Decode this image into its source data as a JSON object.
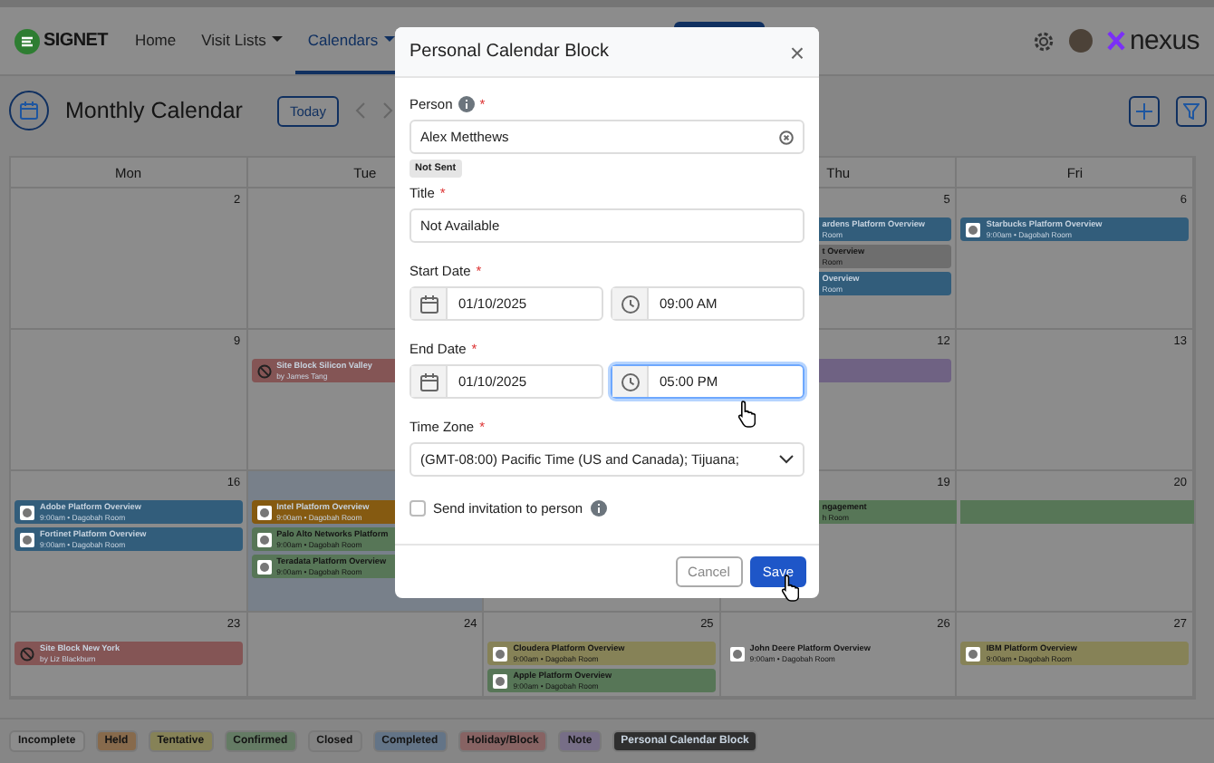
{
  "nav": {
    "logo": "SIGNET",
    "items": [
      {
        "label": "Home",
        "dropdown": false,
        "selected": false
      },
      {
        "label": "Visit Lists",
        "dropdown": true,
        "selected": false
      },
      {
        "label": "Calendars",
        "dropdown": true,
        "selected": true
      }
    ],
    "brand": "nexus"
  },
  "header": {
    "title": "Monthly Calendar",
    "today_button": "Today"
  },
  "calendar": {
    "weekdays": [
      "Mon",
      "Tue",
      "Thu",
      "Fri"
    ],
    "weeks": [
      {
        "days": [
          {
            "number": "2",
            "today": false
          },
          {
            "today": false
          },
          {
            "number": "5",
            "today": false,
            "events": [
              {
                "kind": "plain",
                "color": "#325d7b",
                "title": "ardens Platform Overview",
                "detail": "Room",
                "span": false
              },
              {
                "kind": "plain",
                "color": "#6e6e6e",
                "title": "t Overview",
                "detail": "Room",
                "span": false
              },
              {
                "kind": "plain",
                "color": "#325d7b",
                "title": "Overview",
                "detail": "Room",
                "span": false
              }
            ]
          },
          {
            "number": "6",
            "today": false,
            "events": [
              {
                "kind": "logo",
                "color": "#325d7b",
                "title": "Starbucks Platform Overview",
                "detail": "9:00am • Dagobah Room",
                "span": false
              }
            ]
          }
        ]
      },
      {
        "days": [
          {
            "number": "9",
            "today": false
          },
          {
            "today": false,
            "events": [
              {
                "kind": "block",
                "color": "#845555",
                "title": "Site Block Silicon Valley",
                "detail": "by James Tang",
                "span": false
              }
            ]
          },
          {
            "number": "12",
            "today": false,
            "events": [
              {
                "kind": "bar",
                "color": "#6f6283",
                "span": false
              }
            ]
          },
          {
            "number": "13",
            "today": false
          }
        ]
      },
      {
        "days": [
          {
            "number": "16",
            "today": false,
            "events": [
              {
                "kind": "logo",
                "color": "#325d7b",
                "title": "Adobe Platform Overview",
                "detail": "9:00am • Dagobah Room",
                "span": false
              },
              {
                "kind": "logo",
                "color": "#325d7b",
                "title": "Fortinet Platform Overview",
                "detail": "9:00am • Dagobah Room",
                "span": false
              }
            ]
          },
          {
            "today": true,
            "events": [
              {
                "kind": "logo",
                "color": "#855a11",
                "title": "Intel Platform Overview",
                "detail": "9:00am • Dagobah Room",
                "span": false
              },
              {
                "kind": "logo",
                "color": "#577657",
                "title": "Palo Alto Networks Platform",
                "detail": "9:00am • Dagobah Room",
                "span": false
              },
              {
                "kind": "logo",
                "color": "#577657",
                "title": "Teradata Platform Overview",
                "detail": "9:00am • Dagobah Room",
                "span": false
              }
            ]
          },
          {
            "number": "19",
            "today": false,
            "events": [
              {
                "kind": "plain",
                "color": "#577657",
                "title": "ngagement",
                "detail": "h Room",
                "span": true
              }
            ]
          },
          {
            "number": "20",
            "today": false,
            "events": [
              {
                "kind": "bar",
                "color": "#577657",
                "span": true
              }
            ]
          }
        ]
      },
      {
        "days": [
          {
            "number": "23",
            "today": false,
            "events": [
              {
                "kind": "block",
                "color": "#845555",
                "title": "Site Block New York",
                "detail": "by Liz Blackburn",
                "span": false
              }
            ]
          },
          {
            "number": "24",
            "today": false
          },
          {
            "number": "25",
            "today": false,
            "events": [
              {
                "kind": "logo",
                "color": "#868257",
                "title": "Cloudera Platform Overview",
                "detail": "9:00am • Dagobah Room",
                "span": false
              },
              {
                "kind": "logo",
                "color": "#577657",
                "title": "Apple Platform Overview",
                "detail": "9:00am • Dagobah Room",
                "span": false
              }
            ]
          },
          {
            "number": "26",
            "today": false,
            "events": [
              {
                "kind": "logo",
                "color": "#8c8c8c",
                "title": "John Deere Platform Overview",
                "detail": "9:00am • Dagobah Room",
                "span": false
              }
            ]
          },
          {
            "number": "27",
            "today": false,
            "events": [
              {
                "kind": "logo",
                "color": "#868257",
                "title": "IBM Platform Overview",
                "detail": "9:00am • Dagobah Room",
                "span": false
              }
            ]
          }
        ]
      }
    ]
  },
  "legend": [
    {
      "label": "Incomplete",
      "color": "#8c8c8c"
    },
    {
      "label": "Held",
      "color": "#876a4c"
    },
    {
      "label": "Tentative",
      "color": "#868257"
    },
    {
      "label": "Confirmed",
      "color": "#647b64"
    },
    {
      "label": "Closed",
      "color": "#838383"
    },
    {
      "label": "Completed",
      "color": "#637487"
    },
    {
      "label": "Holiday/Block",
      "color": "#876363"
    },
    {
      "label": "Note",
      "color": "#776e87"
    },
    {
      "label": "Personal Calendar Block",
      "color": "#2f2f2f"
    }
  ],
  "modal": {
    "title": "Personal Calendar Block",
    "close": "×",
    "person": {
      "label": "Person",
      "required": "*",
      "value": "Alex Metthews",
      "badge": "Not Sent"
    },
    "title_field": {
      "label": "Title",
      "required": "*",
      "value": "Not Available"
    },
    "start": {
      "label": "Start Date",
      "required": "*",
      "date": "01/10/2025",
      "time": "09:00 AM",
      "focused": false
    },
    "end": {
      "label": "End Date",
      "required": "*",
      "date": "01/10/2025",
      "time": "05:00 PM",
      "focused": true
    },
    "timezone": {
      "label": "Time Zone",
      "required": "*",
      "value": "(GMT-08:00) Pacific Time (US and Canada); Tijuana;"
    },
    "invite": {
      "label": "Send invitation to person",
      "checked": false
    },
    "buttons": [
      {
        "label": "Cancel",
        "kind": "secondary"
      },
      {
        "label": "Save",
        "kind": "primary"
      }
    ]
  }
}
